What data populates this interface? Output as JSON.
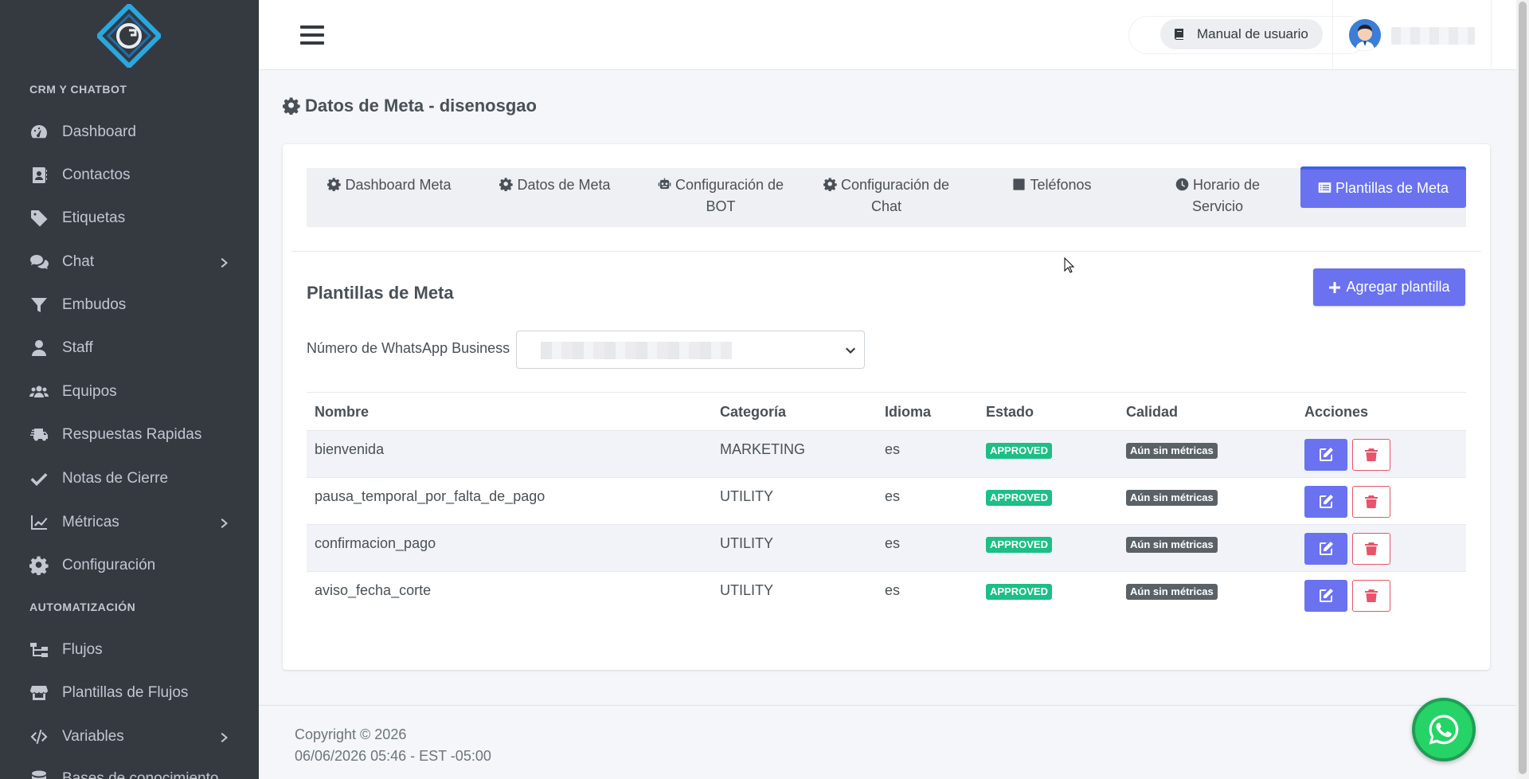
{
  "sidebar": {
    "heading_crm": "CRM Y CHATBOT",
    "heading_auto": "AUTOMATIZACIÓN",
    "items": [
      {
        "label": "Dashboard",
        "icon": "tachometer-icon"
      },
      {
        "label": "Contactos",
        "icon": "address-book-icon"
      },
      {
        "label": "Etiquetas",
        "icon": "tag-icon"
      },
      {
        "label": "Chat",
        "icon": "comments-icon",
        "has_submenu": true
      },
      {
        "label": "Embudos",
        "icon": "filter-icon"
      },
      {
        "label": "Staff",
        "icon": "user-icon"
      },
      {
        "label": "Equipos",
        "icon": "users-icon"
      },
      {
        "label": "Respuestas Rapidas",
        "icon": "truck-fast-icon"
      },
      {
        "label": "Notas de Cierre",
        "icon": "check-icon"
      },
      {
        "label": "Métricas",
        "icon": "chart-line-icon",
        "has_submenu": true
      },
      {
        "label": "Configuración",
        "icon": "gear-icon"
      },
      {
        "label": "Flujos",
        "icon": "sitemap-icon"
      },
      {
        "label": "Plantillas de Flujos",
        "icon": "store-icon"
      },
      {
        "label": "Variables",
        "icon": "code-icon",
        "has_submenu": true
      },
      {
        "label": "Bases de conocimiento",
        "icon": "database-icon"
      }
    ]
  },
  "topbar": {
    "manual_label": "Manual de usuario"
  },
  "page": {
    "title": "Datos de Meta - disenosgao"
  },
  "tabs": [
    {
      "label": "Dashboard Meta",
      "line2": ""
    },
    {
      "label": "Datos de Meta",
      "line2": ""
    },
    {
      "label": "Configuración de",
      "line2": "BOT"
    },
    {
      "label": "Configuración de",
      "line2": "Chat"
    },
    {
      "label": "Teléfonos",
      "line2": ""
    },
    {
      "label": "Horario de",
      "line2": "Servicio"
    },
    {
      "label": "Plantillas de Meta",
      "line2": ""
    }
  ],
  "templates": {
    "section_title": "Plantillas de Meta",
    "add_label": "Agregar plantilla",
    "wa_label": "Número de WhatsApp Business",
    "columns": [
      "Nombre",
      "Categoría",
      "Idioma",
      "Estado",
      "Calidad",
      "Acciones"
    ],
    "rows": [
      {
        "name": "bienvenida",
        "category": "MARKETING",
        "language": "es",
        "status": "APPROVED",
        "quality": "Aún sin métricas"
      },
      {
        "name": "pausa_temporal_por_falta_de_pago",
        "category": "UTILITY",
        "language": "es",
        "status": "APPROVED",
        "quality": "Aún sin métricas"
      },
      {
        "name": "confirmacion_pago",
        "category": "UTILITY",
        "language": "es",
        "status": "APPROVED",
        "quality": "Aún sin métricas"
      },
      {
        "name": "aviso_fecha_corte",
        "category": "UTILITY",
        "language": "es",
        "status": "APPROVED",
        "quality": "Aún sin métricas"
      }
    ]
  },
  "footer": {
    "copyright": "Copyright © 2026",
    "datetime": "06/06/2026 05:46 - EST -05:00"
  },
  "colors": {
    "sidebar_bg": "#343a40",
    "accent": "#6a72f0",
    "success": "#1cbf86",
    "danger": "#e8546b",
    "whatsapp": "#25d366"
  }
}
